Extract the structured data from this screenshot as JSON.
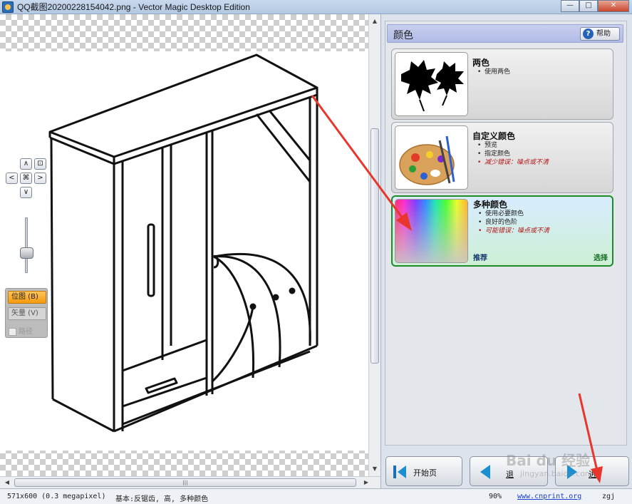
{
  "window": {
    "title": "QQ截图20200228154042.png - Vector Magic Desktop Edition",
    "controls": {
      "minimize": "—",
      "maximize": "□",
      "close": "✕"
    }
  },
  "nav": {
    "up": "∧",
    "down": "∨",
    "left": "<",
    "right": ">",
    "center": "⌘",
    "fit": "⊡"
  },
  "modes": {
    "bitmap": "位图 (B)",
    "vector": "矢量 (V)",
    "path": "路径",
    "path_checked": false
  },
  "panel": {
    "header": "颜色",
    "help": "帮助",
    "options": [
      {
        "title": "两色",
        "bullets": [
          {
            "text": "使用两色",
            "warn": false
          }
        ]
      },
      {
        "title": "自定义颜色",
        "bullets": [
          {
            "text": "预览",
            "warn": false
          },
          {
            "text": "指定颜色",
            "warn": false
          },
          {
            "text": "减少错误：噪点或不清",
            "warn": true
          }
        ]
      },
      {
        "title": "多种颜色",
        "bullets": [
          {
            "text": "使用必要颜色",
            "warn": false
          },
          {
            "text": "良好的色阶",
            "warn": false
          },
          {
            "text": "可能错误：噪点或不清",
            "warn": true
          }
        ],
        "recommend": "推荐",
        "choose": "选择",
        "selected": true
      }
    ]
  },
  "wizard": {
    "start": "开始页",
    "back": "退",
    "next": "进"
  },
  "statusbar": {
    "size": "571x600 (0.3 megapixel)",
    "mode": "基本:反锯齿, 高, 多种颜色",
    "zoom": "90%",
    "link": "www.cnprint.org",
    "user": "zgj"
  },
  "watermark": {
    "text": "Bai du 经验",
    "url": "jingyan.baidu.com"
  },
  "colors": {
    "selected_border": "#1e8a2a",
    "active_mode": "#f59a0e",
    "annotation": "#e8362c",
    "header": "#b9c2ea"
  }
}
